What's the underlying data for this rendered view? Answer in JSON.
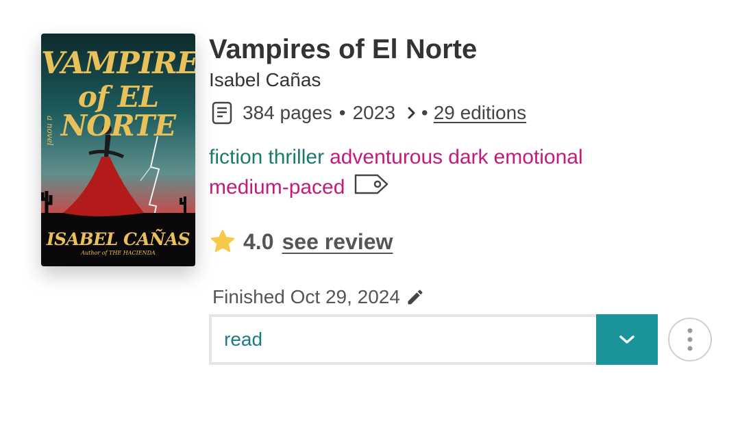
{
  "cover": {
    "title_line1": "VAMPIRES",
    "title_line2": "of EL NORTE",
    "subtitle": "a novel",
    "author": "ISABEL CAÑAS",
    "tagline": "Author of THE HACIENDA"
  },
  "book": {
    "title": "Vampires of El Norte",
    "author": "Isabel Cañas",
    "pages": "384 pages",
    "separator": "•",
    "year": "2023",
    "editions": "29 editions"
  },
  "tags": {
    "genres": [
      "fiction",
      "thriller"
    ],
    "moods": [
      "adventurous",
      "dark",
      "emotional",
      "medium-paced"
    ]
  },
  "rating": {
    "value": "4.0",
    "review_link": "see review"
  },
  "finished": {
    "label": "Finished Oct 29, 2024"
  },
  "status": {
    "value": "read"
  },
  "colors": {
    "genre": "#1b7a6b",
    "mood": "#c21a7d",
    "accent": "#1a939b",
    "star": "#f7c948"
  }
}
